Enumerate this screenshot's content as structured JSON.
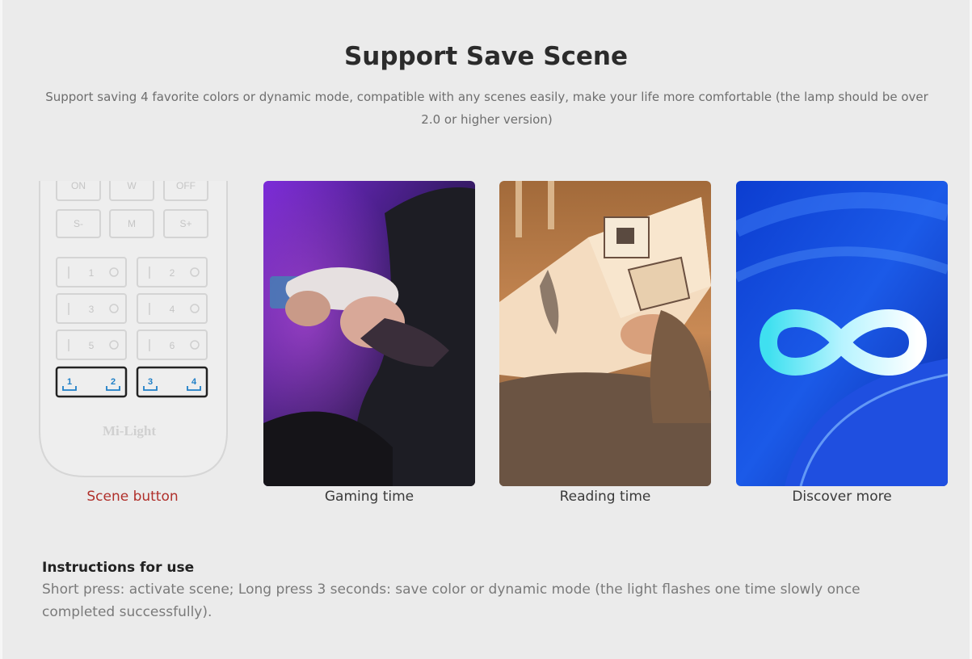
{
  "title": "Support Save Scene",
  "subtitle": "Support saving 4 favorite colors or dynamic mode, compatible with any scenes easily, make your life more comfortable (the lamp should be over 2.0 or higher version)",
  "remote": {
    "top_buttons": [
      "ON",
      "W",
      "OFF"
    ],
    "mid_buttons": [
      "S-",
      "M",
      "S+"
    ],
    "zone_buttons": [
      "1",
      "2",
      "3",
      "4",
      "5",
      "6"
    ],
    "scene_buttons": [
      "1",
      "2",
      "3",
      "4"
    ],
    "brand": "Mi-Light"
  },
  "cards": [
    {
      "caption": "Scene button"
    },
    {
      "caption": "Gaming time"
    },
    {
      "caption": "Reading time"
    },
    {
      "caption": "Discover more"
    }
  ],
  "instructions": {
    "heading": "Instructions for use",
    "body": "Short press: activate scene; Long press 3 seconds: save color or dynamic mode (the light flashes one time slowly once completed successfully)."
  },
  "colors": {
    "caption_accent": "#b0302b",
    "gaming_accent": "#8a2be2",
    "reading_accent": "#c98a4a",
    "discover_accent": "#1a4fd8"
  }
}
